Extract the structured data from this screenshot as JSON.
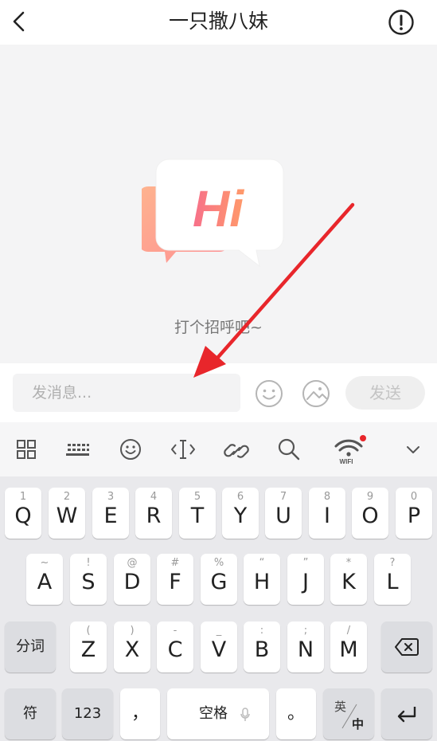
{
  "header": {
    "title": "一只撒八妹",
    "back_icon": "chevron-left-icon",
    "report_icon": "exclamation-circle-icon"
  },
  "chat": {
    "hi_text": "Hi",
    "greeting": "打个招呼吧~"
  },
  "input_bar": {
    "placeholder": "发消息...",
    "emoji_icon": "smiley-icon",
    "image_icon": "image-icon",
    "send_label": "发送"
  },
  "keyboard_toolbar": {
    "items": [
      "grid-icon",
      "keyboard-icon",
      "smiley-icon",
      "cursor-icon",
      "link-icon",
      "search-icon",
      "wifi-icon",
      "chevron-down-icon"
    ],
    "wifi_label": "WIFI"
  },
  "keyboard": {
    "row1": [
      {
        "main": "Q",
        "sub": "1"
      },
      {
        "main": "W",
        "sub": "2"
      },
      {
        "main": "E",
        "sub": "3"
      },
      {
        "main": "R",
        "sub": "4"
      },
      {
        "main": "T",
        "sub": "5"
      },
      {
        "main": "Y",
        "sub": "6"
      },
      {
        "main": "U",
        "sub": "7"
      },
      {
        "main": "I",
        "sub": "8"
      },
      {
        "main": "O",
        "sub": "9"
      },
      {
        "main": "P",
        "sub": "0"
      }
    ],
    "row2": [
      {
        "main": "A",
        "sub": "~"
      },
      {
        "main": "S",
        "sub": "!"
      },
      {
        "main": "D",
        "sub": "@"
      },
      {
        "main": "F",
        "sub": "#"
      },
      {
        "main": "G",
        "sub": "%"
      },
      {
        "main": "H",
        "sub": "“"
      },
      {
        "main": "J",
        "sub": "”"
      },
      {
        "main": "K",
        "sub": "*"
      },
      {
        "main": "L",
        "sub": "?"
      }
    ],
    "row3": [
      {
        "main": "Z",
        "sub": "("
      },
      {
        "main": "X",
        "sub": ")"
      },
      {
        "main": "C",
        "sub": "-"
      },
      {
        "main": "V",
        "sub": "_"
      },
      {
        "main": "B",
        "sub": ":"
      },
      {
        "main": "N",
        "sub": ";"
      },
      {
        "main": "M",
        "sub": "/"
      }
    ],
    "fenci_label": "分词",
    "fu_label": "符",
    "num_label": "123",
    "comma_label": "，",
    "space_label": "空格",
    "period_label": "。",
    "lang_top": "英",
    "lang_bottom": "中"
  },
  "colors": {
    "annotation_arrow": "#e8262b",
    "hi_gradient_start": "#f7708a",
    "hi_gradient_end": "#ff9a6a"
  }
}
